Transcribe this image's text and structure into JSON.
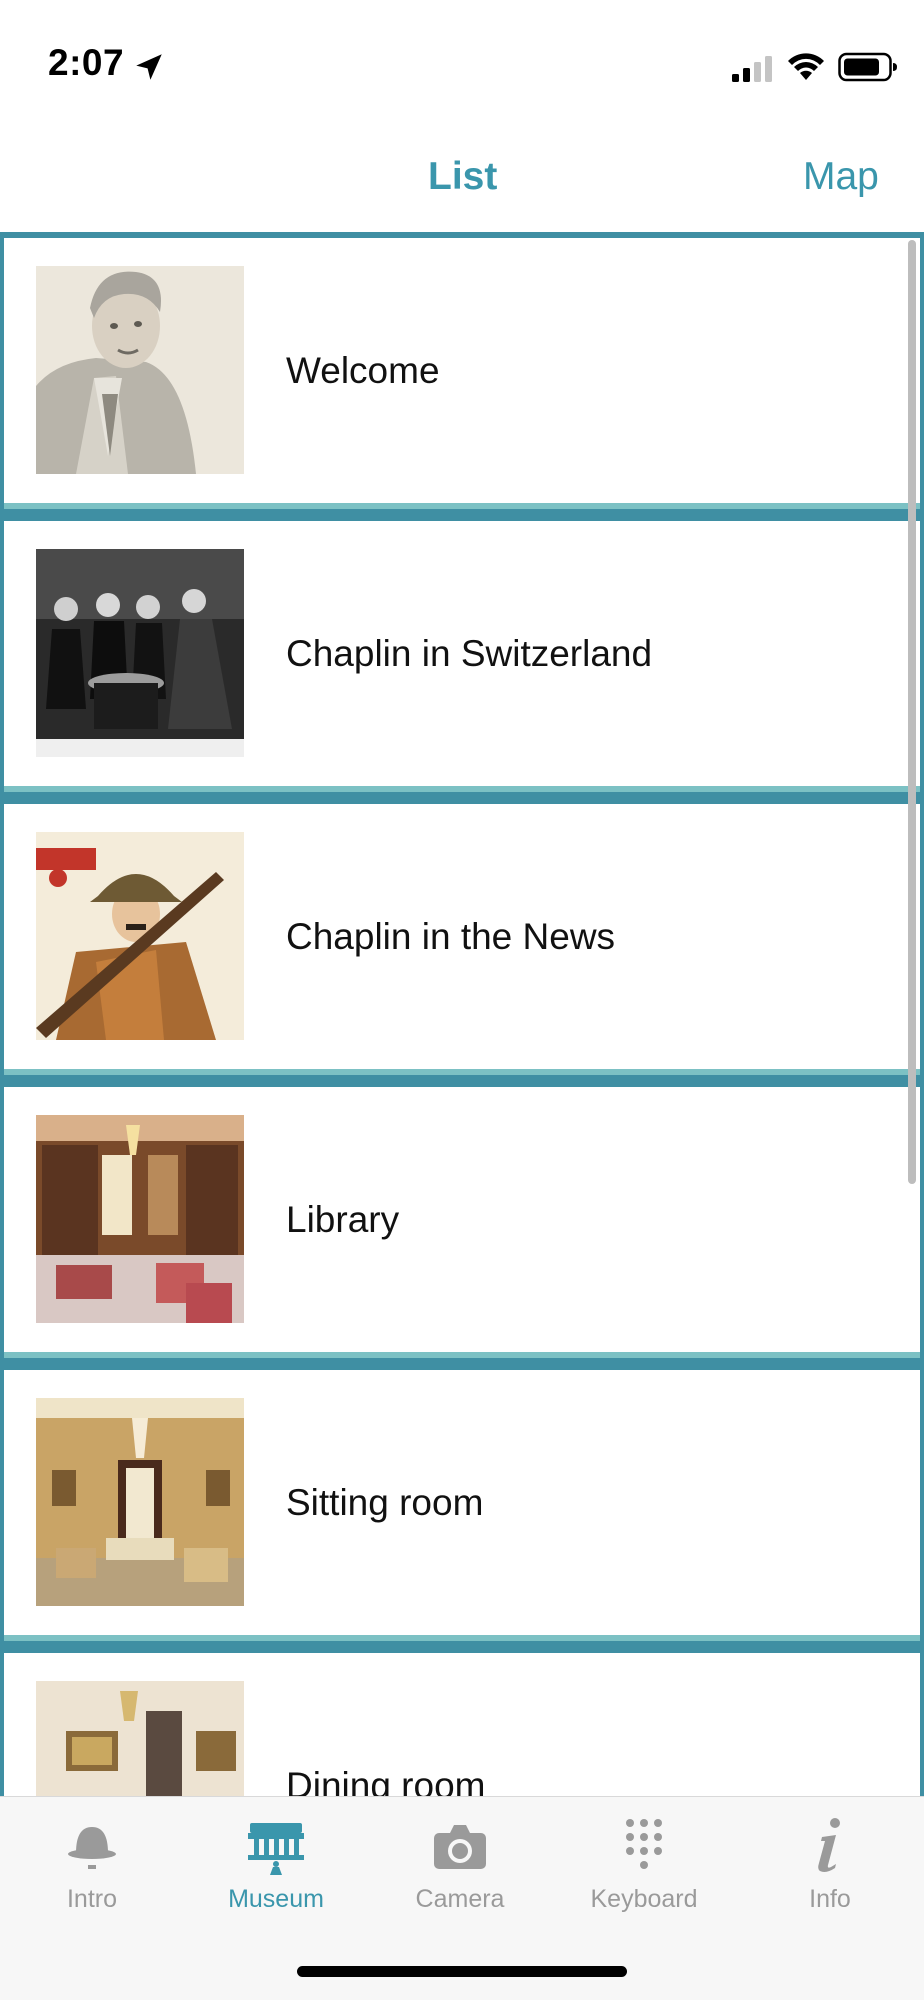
{
  "status_bar": {
    "time": "2:07"
  },
  "header": {
    "tabs": [
      {
        "label": "List",
        "selected": true
      },
      {
        "label": "Map",
        "selected": false
      }
    ],
    "accent_color": "#3a96ac"
  },
  "list": {
    "items": [
      {
        "title": "Welcome",
        "thumbnail": "portrait-photo"
      },
      {
        "title": "Chaplin in Switzerland",
        "thumbnail": "group-photo"
      },
      {
        "title": "Chaplin in the News",
        "thumbnail": "magazine-cover"
      },
      {
        "title": "Library",
        "thumbnail": "library-photo"
      },
      {
        "title": "Sitting room",
        "thumbnail": "sitting-room-photo"
      },
      {
        "title": "Dining room",
        "thumbnail": "dining-room-photo"
      }
    ],
    "background_color": "#3f8fa3"
  },
  "tab_bar": {
    "items": [
      {
        "label": "Intro",
        "icon": "bowler-hat-icon",
        "active": false
      },
      {
        "label": "Museum",
        "icon": "museum-building-icon",
        "active": true
      },
      {
        "label": "Camera",
        "icon": "camera-icon",
        "active": false
      },
      {
        "label": "Keyboard",
        "icon": "keypad-icon",
        "active": false
      },
      {
        "label": "Info",
        "icon": "info-icon",
        "active": false
      }
    ],
    "active_color": "#3a96ac",
    "inactive_color": "#9a9a9a"
  }
}
